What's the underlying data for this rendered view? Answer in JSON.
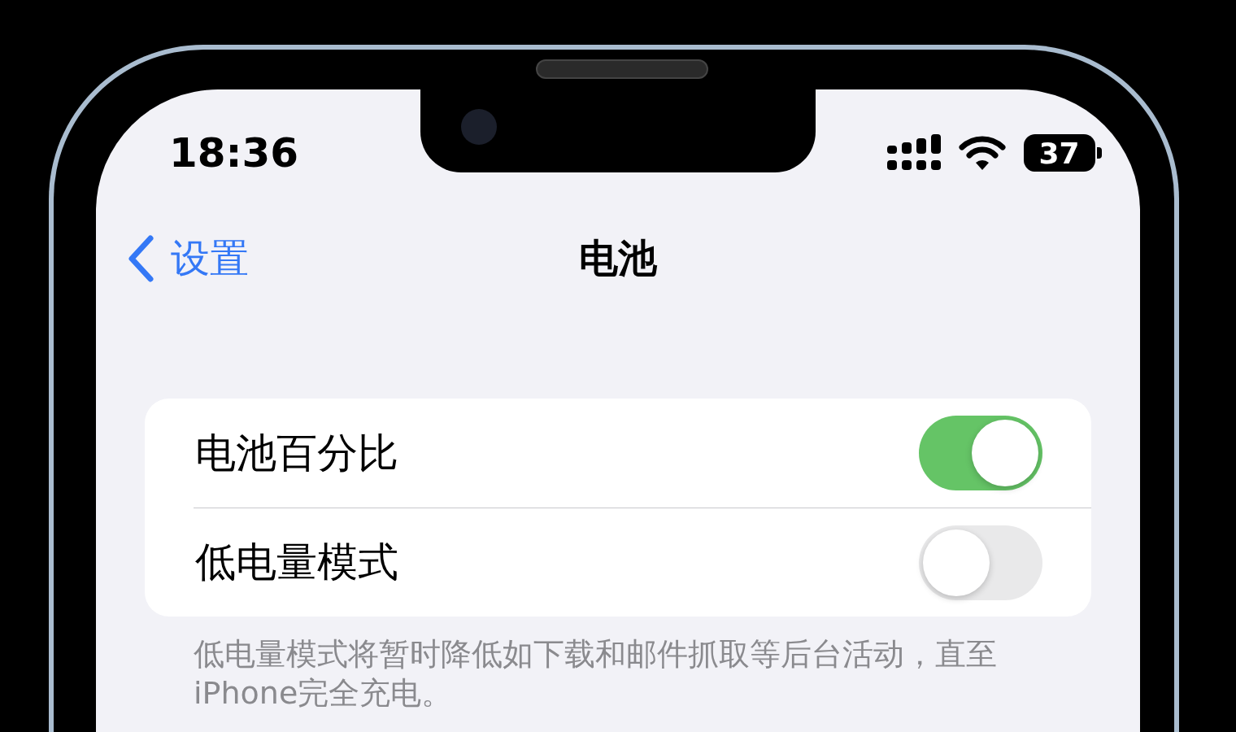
{
  "status_bar": {
    "time": "18:36",
    "battery": "37"
  },
  "nav": {
    "back": "设置",
    "title": "电池"
  },
  "settings": [
    {
      "label": "电池百分比",
      "on": true
    },
    {
      "label": "低电量模式",
      "on": false
    }
  ],
  "footer": "低电量模式将暂时降低如下载和邮件抓取等后台活动，直至iPhone完全充电。"
}
